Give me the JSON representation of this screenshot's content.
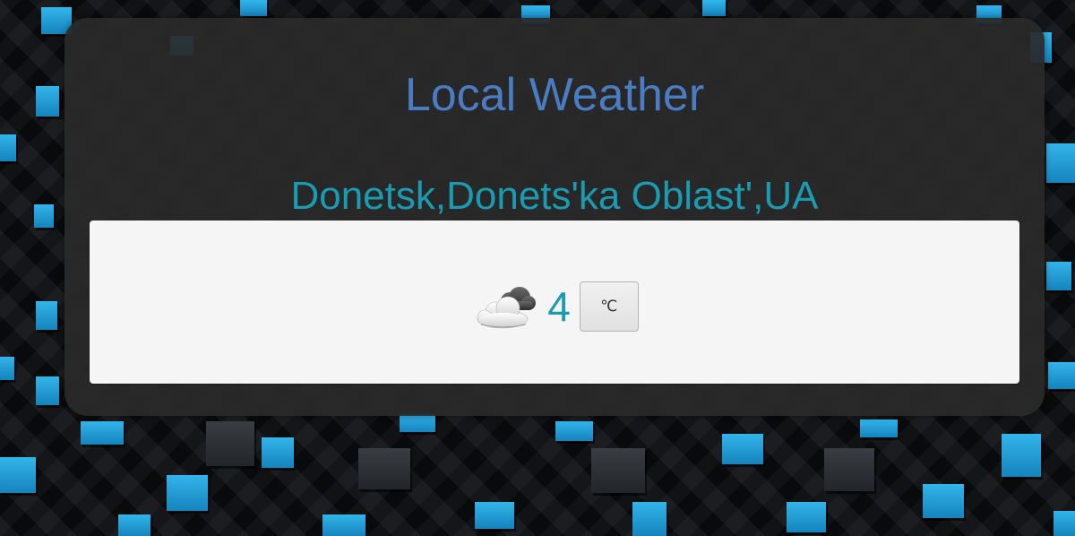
{
  "header": {
    "title": "Local Weather"
  },
  "location": {
    "name": "Donetsk,Donets'ka Oblast',UA"
  },
  "weather": {
    "condition_icon": "cloud-icon",
    "temperature": "4",
    "unit_label": "℃"
  },
  "colors": {
    "title": "#4a7cc2",
    "accent": "#1a9bb2",
    "panel": "#2a2a2a",
    "card": "#f5f5f5",
    "tile_blue": "#1e9ad6"
  }
}
